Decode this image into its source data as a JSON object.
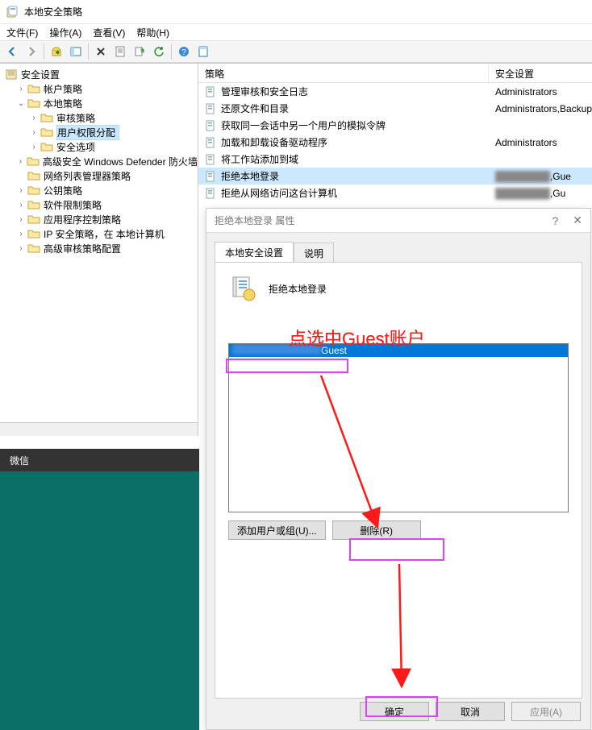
{
  "window": {
    "title": "本地安全策略"
  },
  "menu": {
    "file": "文件(F)",
    "action": "操作(A)",
    "view": "查看(V)",
    "help": "帮助(H)"
  },
  "tree": {
    "root": "安全设置",
    "items": [
      {
        "label": "帐户策略",
        "level": 1,
        "expand": ">"
      },
      {
        "label": "本地策略",
        "level": 1,
        "expand": "v"
      },
      {
        "label": "审核策略",
        "level": 2,
        "expand": ">"
      },
      {
        "label": "用户权限分配",
        "level": 2,
        "expand": ">",
        "selected": true
      },
      {
        "label": "安全选项",
        "level": 2,
        "expand": ">"
      },
      {
        "label": "高级安全 Windows Defender 防火墙",
        "level": 1,
        "expand": ">"
      },
      {
        "label": "网络列表管理器策略",
        "level": 1,
        "expand": ""
      },
      {
        "label": "公钥策略",
        "level": 1,
        "expand": ">"
      },
      {
        "label": "软件限制策略",
        "level": 1,
        "expand": ">"
      },
      {
        "label": "应用程序控制策略",
        "level": 1,
        "expand": ">"
      },
      {
        "label": "IP 安全策略，在 本地计算机",
        "level": 1,
        "expand": ">"
      },
      {
        "label": "高级审核策略配置",
        "level": 1,
        "expand": ">"
      }
    ]
  },
  "list": {
    "header_policy": "策略",
    "header_setting": "安全设置",
    "rows": [
      {
        "name": "管理审核和安全日志",
        "setting": "Administrators"
      },
      {
        "name": "还原文件和目录",
        "setting": "Administrators,Backup"
      },
      {
        "name": "获取同一会话中另一个用户的模拟令牌",
        "setting": ""
      },
      {
        "name": "加载和卸载设备驱动程序",
        "setting": "Administrators"
      },
      {
        "name": "将工作站添加到域",
        "setting": ""
      },
      {
        "name": "拒绝本地登录",
        "setting": ",Gue",
        "selected": true,
        "blur": true
      },
      {
        "name": "拒绝从网络访问这台计算机",
        "setting": ",Gu",
        "blur": true
      }
    ]
  },
  "dialog": {
    "title": "拒绝本地登录 属性",
    "tabs": {
      "t1": "本地安全设置",
      "t2": "说明"
    },
    "heading": "拒绝本地登录",
    "list_item_suffix": "Guest",
    "btn_add": "添加用户或组(U)...",
    "btn_remove": "删除(R)",
    "btn_ok": "确定",
    "btn_cancel": "取消",
    "btn_apply": "应用(A)"
  },
  "taskbar": {
    "label": "微信"
  },
  "annotation": {
    "line1": "点选中Guest账户"
  }
}
